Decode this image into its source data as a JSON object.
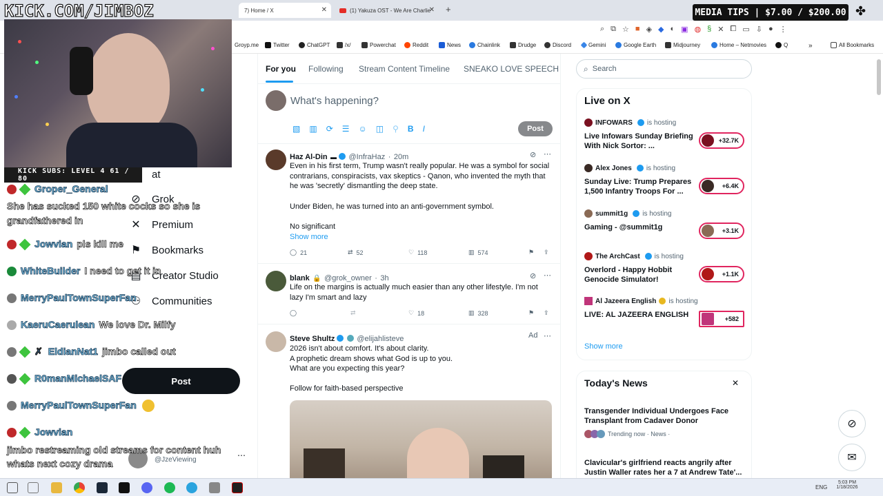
{
  "overlay": {
    "kick_url": "KICK.COM/JIMBOZ",
    "kick_subs": "KICK SUBS: LEVEL 4 61 / 80",
    "media_tips": "MEDIA TIPS | $7.00 / $200.00"
  },
  "browser": {
    "tabs": [
      {
        "label": "7) Home / X"
      },
      {
        "label": "(1) Yakuza OST - We Are Charlie"
      }
    ],
    "new_tab": "+",
    "bookmarks": [
      {
        "label": "Groyp.me"
      },
      {
        "label": "Twitter"
      },
      {
        "label": "ChatGPT"
      },
      {
        "label": "/x/"
      },
      {
        "label": "Powerchat"
      },
      {
        "label": "Reddit"
      },
      {
        "label": "News"
      },
      {
        "label": "Chainlink"
      },
      {
        "label": "Drudge"
      },
      {
        "label": "Discord"
      },
      {
        "label": "Gemini"
      },
      {
        "label": "Google Earth"
      },
      {
        "label": "Midjourney"
      },
      {
        "label": "Home – Netmovies"
      },
      {
        "label": "Q"
      }
    ],
    "all_bookmarks": "All Bookmarks"
  },
  "chat": [
    {
      "user": "Groper_General",
      "msg": ""
    },
    {
      "user": "",
      "msg": "She has sucked 150 white cocks so she is grandfathered in"
    },
    {
      "user": "Jowvian",
      "msg": "pls kill me"
    },
    {
      "user": "WhiteBuilder",
      "msg": "I need to get it in"
    },
    {
      "user": "MerryPaulTownSuperFan",
      "msg": ""
    },
    {
      "user": "KaeruCaerulean",
      "msg": "We love Dr. Milfy"
    },
    {
      "user": "EldianNat1",
      "msg": "jimbo called out"
    },
    {
      "user": "R0manMichaelSAF",
      "msg": ""
    },
    {
      "user": "MerryPaulTownSuperFan",
      "msg": ""
    },
    {
      "user": "Jowvian",
      "msg": ""
    },
    {
      "user": "",
      "msg": "jimbo restreaming old streams for content huh whats next cozy drama"
    }
  ],
  "nav": {
    "items": [
      {
        "label": "at"
      },
      {
        "label": "Grok"
      },
      {
        "label": "Premium"
      },
      {
        "label": "Bookmarks"
      },
      {
        "label": "Creator Studio"
      },
      {
        "label": "Communities"
      }
    ],
    "post": "Post",
    "account_handle": "@JzeViewing"
  },
  "timeline": {
    "tabs": [
      {
        "label": "For you"
      },
      {
        "label": "Following"
      },
      {
        "label": "Stream Content Timeline"
      },
      {
        "label": "SNEAKO LOVE SPEECH"
      }
    ],
    "composer_placeholder": "What's happening?",
    "composer_post": "Post",
    "tweets": [
      {
        "name": "Haz Al-Din",
        "handle": "@InfraHaz",
        "time": "20m",
        "text1": "Even in his first term, Trump wasn't really popular. He was a symbol for social contrarians, conspiracists, vax skeptics - Qanon, who invented the myth that he was 'secretly' dismantling the deep state.",
        "text2": "Under Biden, he was turned into an anti-government symbol.",
        "text3": "No significant",
        "show_more": "Show more",
        "replies": "21",
        "reposts": "52",
        "likes": "118",
        "views": "574"
      },
      {
        "name": "blank",
        "handle": "@grok_owner",
        "time": "3h",
        "text1": "Life on the margins is actually much easier than any other lifestyle. I'm not lazy I'm smart and lazy",
        "likes": "18",
        "views": "328"
      },
      {
        "name": "Steve Shultz",
        "handle": "@elijahlisteve",
        "ad": "Ad",
        "text1": "2026 isn't about comfort. It's about clarity.",
        "text2": "A prophetic dream shows what God is up to you.",
        "text3": "What are you expecting this year?",
        "text4": "Follow for faith-based perspective"
      }
    ]
  },
  "sidebar": {
    "search_placeholder": "Search",
    "live_title": "Live on X",
    "hosting": "is hosting",
    "live": [
      {
        "host": "INFOWARS",
        "title": "Live Infowars Sunday Briefing With Nick Sortor: ...",
        "count": "+32.7K",
        "color": "#7a1020"
      },
      {
        "host": "Alex Jones",
        "title": "Sunday Live: Trump Prepares 1,500 Infantry Troops For ...",
        "count": "+6.4K",
        "color": "#3a2a25"
      },
      {
        "host": "summit1g",
        "title": "Gaming - @summit1g",
        "count": "+3.1K",
        "color": "#8a6a55"
      },
      {
        "host": "The ArchCast",
        "title": "Overlord - Happy Hobbit Genocide Simulator!",
        "count": "+1.1K",
        "color": "#b01818"
      },
      {
        "host": "Al Jazeera English",
        "title": "LIVE: AL JAZEERA ENGLISH",
        "count": "+582",
        "color": "#c0357a"
      }
    ],
    "show_more": "Show more",
    "news_title": "Today's News",
    "news": [
      {
        "title": "Transgender Individual Undergoes Face Transplant from Cadaver Donor",
        "meta": "Trending now · News ·"
      },
      {
        "title": "Clavicular's girlfriend reacts angrily after Justin Waller rates her a 7 at Andrew Tate'..."
      }
    ]
  },
  "taskbar": {
    "lang": "ENG",
    "time": "5:03 PM",
    "date": "1/18/2026"
  }
}
